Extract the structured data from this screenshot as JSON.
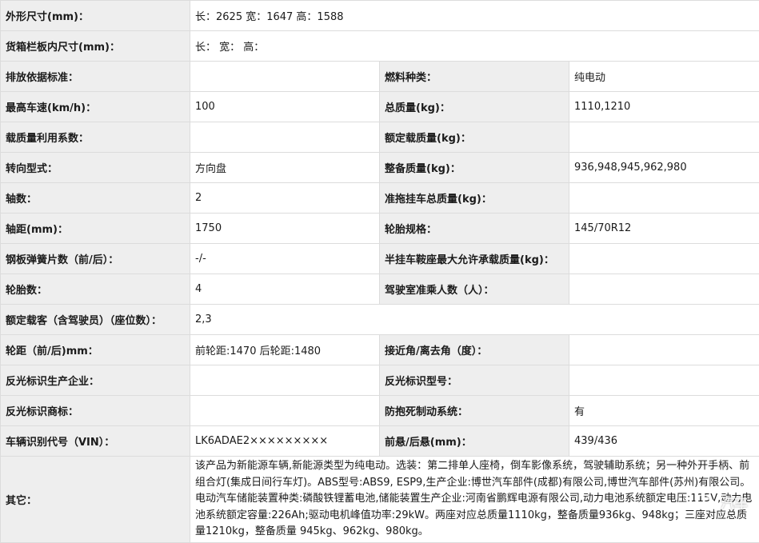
{
  "rows": [
    {
      "label": "外形尺寸(mm)：",
      "value": "长：2625 宽：1647 高：1588"
    },
    {
      "label": "货箱栏板内尺寸(mm)：",
      "value": "长：  宽：  高："
    },
    {
      "label": "排放依据标准：",
      "value": "",
      "label2": "燃料种类：",
      "value2": "纯电动"
    },
    {
      "label": "最高车速(km/h)：",
      "value": "100",
      "label2": "总质量(kg)：",
      "value2": "1110,1210"
    },
    {
      "label": "载质量利用系数：",
      "value": "",
      "label2": "额定载质量(kg)：",
      "value2": ""
    },
    {
      "label": "转向型式：",
      "value": "方向盘",
      "label2": "整备质量(kg)：",
      "value2": "936,948,945,962,980"
    },
    {
      "label": "轴数：",
      "value": "2",
      "label2": "准拖挂车总质量(kg)：",
      "value2": ""
    },
    {
      "label": "轴距(mm)：",
      "value": "1750",
      "label2": "轮胎规格：",
      "value2": "145/70R12"
    },
    {
      "label": "钢板弹簧片数（前/后）：",
      "value": "-/-",
      "label2": "半挂车鞍座最大允许承载质量(kg)：",
      "value2": ""
    },
    {
      "label": "轮胎数：",
      "value": "4",
      "label2": "驾驶室准乘人数（人）：",
      "value2": ""
    },
    {
      "label": "额定载客（含驾驶员）（座位数）：",
      "value": "2,3"
    },
    {
      "label": "轮距（前/后)mm：",
      "value": "前轮距:1470 后轮距:1480",
      "label2": "接近角/离去角（度）：",
      "value2": ""
    },
    {
      "label": "反光标识生产企业：",
      "value": "",
      "label2": "反光标识型号：",
      "value2": ""
    },
    {
      "label": "反光标识商标：",
      "value": "",
      "label2": "防抱死制动系统：",
      "value2": "有"
    },
    {
      "label": "车辆识别代号（VIN）：",
      "value": "LK6ADAE2×××××××××",
      "label2": "前悬/后悬(mm)：",
      "value2": "439/436"
    }
  ],
  "other": {
    "label": "其它：",
    "value": "该产品为新能源车辆,新能源类型为纯电动。选装：第二排单人座椅，倒车影像系统，驾驶辅助系统；另一种外开手柄、前组合灯(集成日间行车灯)。ABS型号:ABS9, ESP9,生产企业:博世汽车部件(成都)有限公司,博世汽车部件(苏州)有限公司。电动汽车储能装置种类:磷酸铁锂蓄电池,储能装置生产企业:河南省鹏辉电源有限公司,动力电池系统额定电压:115V,动力电池系统额定容量:226Ah;驱动电机峰值功率:29kW。两座对应总质量1110kg，整备质量936kg、948kg；三座对应总质量1210kg，整备质量 945kg、962kg、980kg。"
  },
  "watermark": {
    "text": "汽车",
    "icon": "wechat-icon"
  }
}
